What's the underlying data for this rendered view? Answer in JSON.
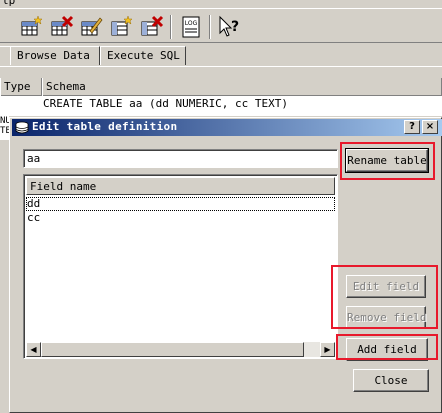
{
  "menubar": {
    "fragment": "lp"
  },
  "toolbar": {
    "icons": [
      "create-table-icon",
      "delete-table-icon",
      "modify-table-icon",
      "create-index-icon",
      "delete-index-icon",
      "log-icon",
      "whats-this-icon"
    ],
    "log_label": "LOG"
  },
  "tabs": [
    {
      "label": ""
    },
    {
      "label": "Browse Data"
    },
    {
      "label": "Execute SQL"
    }
  ],
  "grid": {
    "columns": [
      "Type",
      "Schema"
    ],
    "row": {
      "schema": "CREATE TABLE aa (dd NUMERIC, cc TEXT)",
      "side_fragments": [
        "NU",
        "TE"
      ]
    }
  },
  "dialog": {
    "title": "Edit table definition",
    "help_button": "?",
    "close_x": "×",
    "table_name": "aa",
    "rename_button": "Rename table",
    "field_list": {
      "header": "Field name",
      "rows": [
        "dd",
        "cc"
      ],
      "selected_index": 0
    },
    "edit_field_button": "Edit field",
    "remove_field_button": "Remove field",
    "add_field_button": "Add field",
    "close_button": "Close"
  },
  "colors": {
    "title_gradient_start": "#0a246a",
    "title_gradient_end": "#a6caf0",
    "annotation_red": "#e8192c",
    "face": "#d4d0c8"
  }
}
